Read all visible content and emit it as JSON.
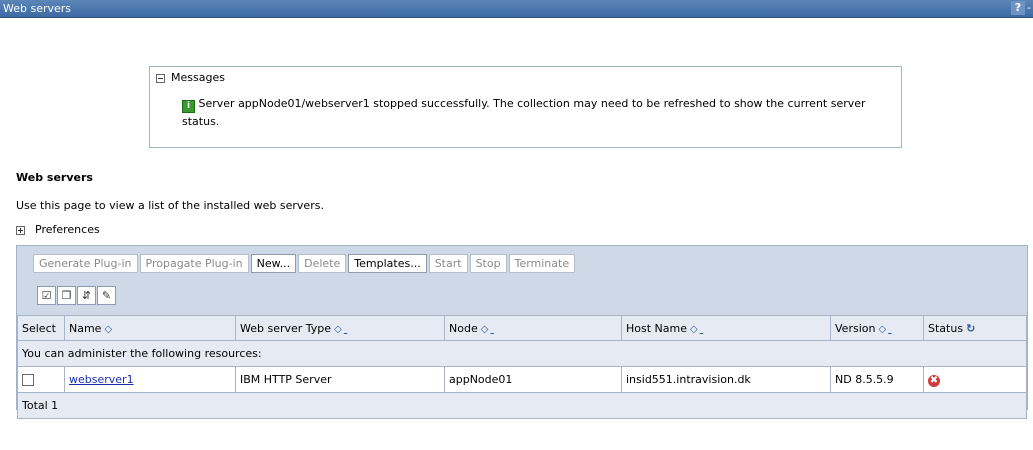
{
  "window": {
    "title": "Web servers",
    "help": "?",
    "minimize": "-"
  },
  "messages": {
    "header": "Messages",
    "text": "Server appNode01/webserver1 stopped successfully. The collection may need to be refreshed to show the current server status."
  },
  "page": {
    "title": "Web servers",
    "description": "Use this page to view a list of the installed web servers.",
    "preferences": "Preferences"
  },
  "toolbar": {
    "generate": "Generate Plug-in",
    "propagate": "Propagate Plug-in",
    "new": "New...",
    "delete": "Delete",
    "templates": "Templates...",
    "start": "Start",
    "stop": "Stop",
    "terminate": "Terminate"
  },
  "icons": {
    "select_all": "select-all-icon",
    "deselect_all": "deselect-all-icon",
    "filter": "show-filter-icon",
    "preferences": "preferences-icon"
  },
  "table": {
    "headers": {
      "select": "Select",
      "name": "Name",
      "type": "Web server Type",
      "node": "Node",
      "host": "Host Name",
      "version": "Version",
      "status": "Status"
    },
    "hint": "You can administer the following resources:",
    "rows": [
      {
        "name": "webserver1",
        "type": "IBM HTTP Server",
        "node": "appNode01",
        "host": "insid551.intravision.dk",
        "version": "ND 8.5.5.9",
        "status": "stopped"
      }
    ],
    "total": "Total 1"
  },
  "colors": {
    "titlebar": "#3c6aa3",
    "panel": "#ced8e7",
    "link": "#1a2fb0",
    "status_stopped": "#d23b3b"
  }
}
